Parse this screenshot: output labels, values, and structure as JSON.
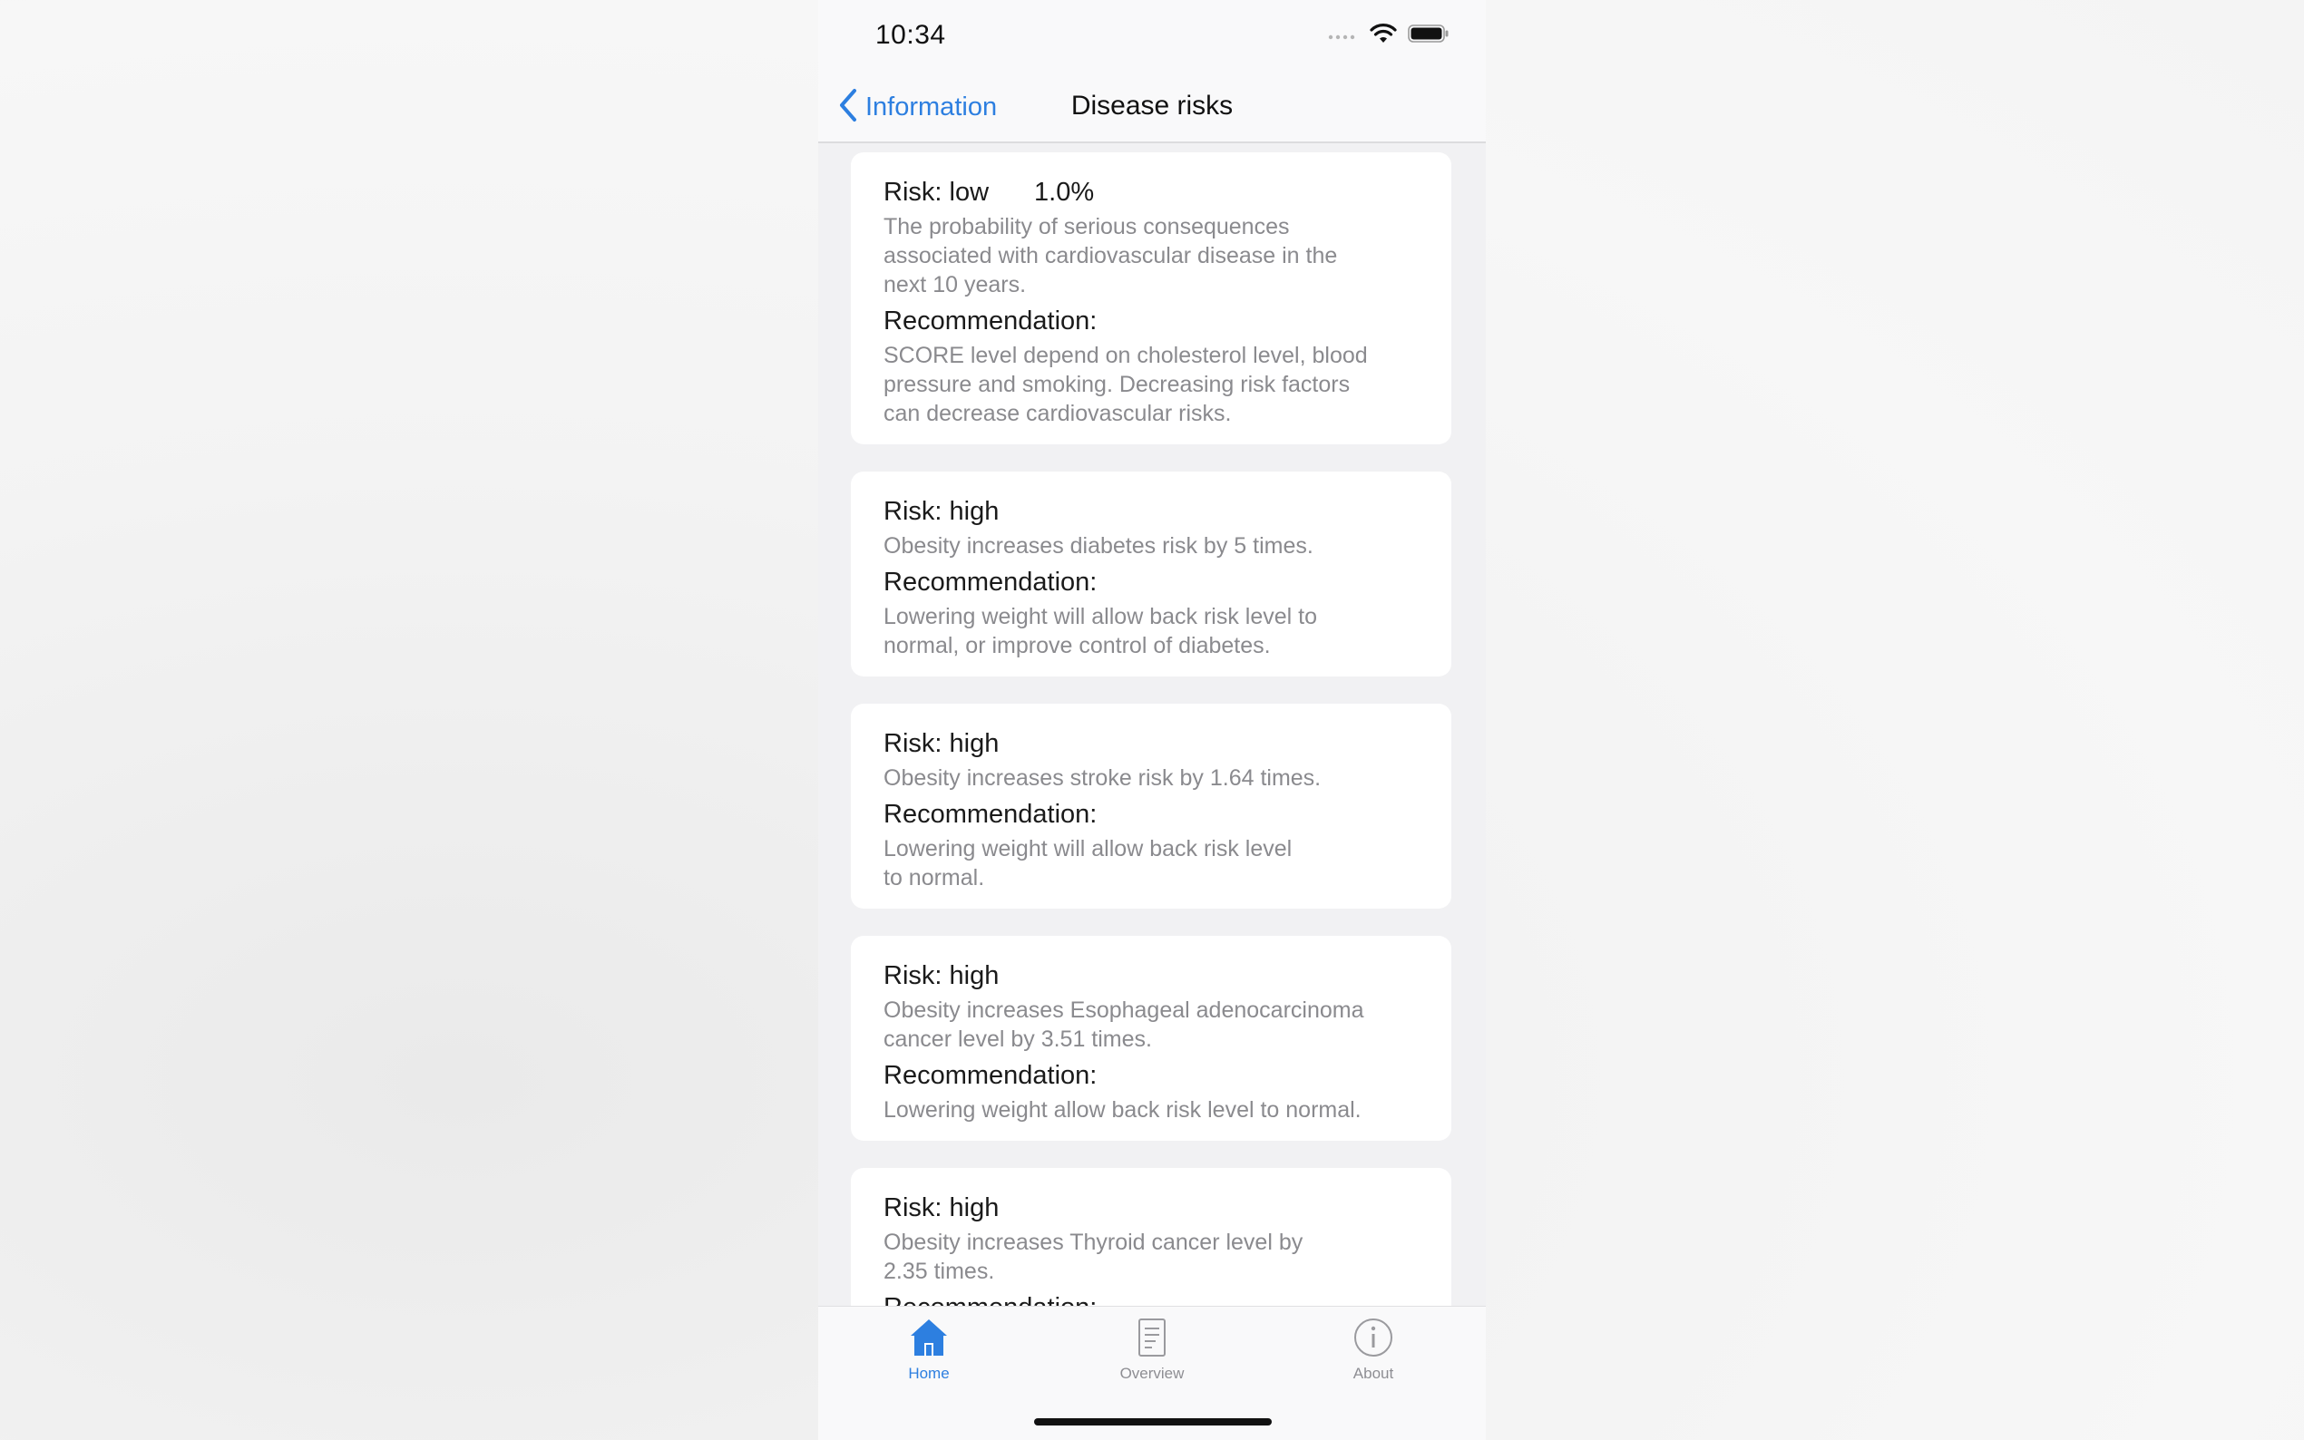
{
  "status_bar": {
    "time": "10:34"
  },
  "nav": {
    "back_label": "Information",
    "title": "Disease risks"
  },
  "cards": [
    {
      "risk": "Risk: low",
      "percent": "1.0%",
      "description_lines": [
        "The probability of serious consequences",
        "associated with cardiovascular disease in the",
        "next 10 years."
      ],
      "recommendation_label": "Recommendation:",
      "recommendation_lines": [
        "SCORE level depend on cholesterol level, blood",
        "pressure and smoking. Decreasing risk factors",
        "can decrease cardiovascular risks."
      ]
    },
    {
      "risk": "Risk: high",
      "description_lines": [
        "Obesity increases diabetes risk by 5 times."
      ],
      "recommendation_label": "Recommendation:",
      "recommendation_lines": [
        "Lowering weight will allow back risk level to",
        "normal, or improve control of diabetes."
      ]
    },
    {
      "risk": "Risk: high",
      "description_lines": [
        "Obesity increases stroke risk by 1.64 times."
      ],
      "recommendation_label": "Recommendation:",
      "recommendation_lines": [
        "Lowering weight will allow back risk level",
        "to normal."
      ]
    },
    {
      "risk": "Risk: high",
      "description_lines": [
        "Obesity increases Esophageal adenocarcinoma",
        "cancer level by 3.51 times."
      ],
      "recommendation_label": "Recommendation:",
      "recommendation_lines": [
        "Lowering weight allow back risk level to normal."
      ]
    },
    {
      "risk": "Risk: high",
      "description_lines": [
        "Obesity increases Thyroid cancer level by",
        "2.35 times."
      ],
      "recommendation_label": "Recommendation:",
      "recommendation_lines": []
    }
  ],
  "tabs": [
    {
      "label": "Home",
      "icon": "home-icon",
      "active": true
    },
    {
      "label": "Overview",
      "icon": "document-icon",
      "active": false
    },
    {
      "label": "About",
      "icon": "info-icon",
      "active": false
    }
  ],
  "colors": {
    "accent": "#2d7fe0",
    "secondary_text": "#8a8a8e",
    "background": "#f1f1f3"
  }
}
